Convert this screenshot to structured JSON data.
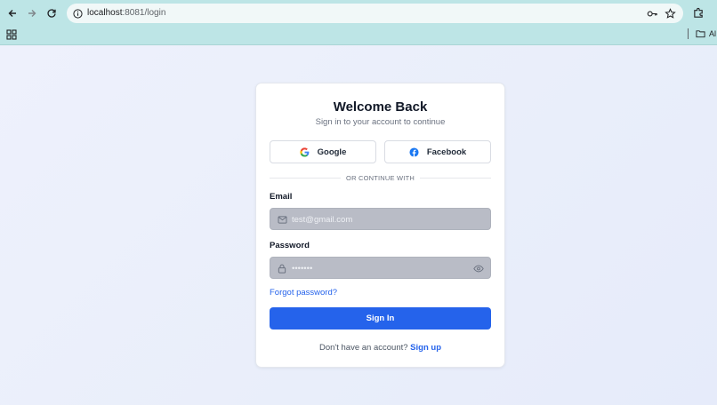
{
  "browser": {
    "url_host": "localhost",
    "url_path": ":8081/login",
    "bookmark_folder": "Al"
  },
  "login": {
    "title": "Welcome Back",
    "subtitle": "Sign in to your account to continue",
    "google_label": "Google",
    "facebook_label": "Facebook",
    "divider_text": "OR CONTINUE WITH",
    "email_label": "Email",
    "email_placeholder": "test@gmail.com",
    "password_label": "Password",
    "password_value": "•••••••",
    "forgot_label": "Forgot password?",
    "signin_label": "Sign In",
    "no_account_text": "Don't have an account?",
    "signup_label": "Sign up"
  },
  "colors": {
    "accent": "#2563eb",
    "chrome": "#bde5e6",
    "field_bg": "#b9bcc6"
  },
  "icons": {
    "back": "arrow-left-icon",
    "forward": "arrow-right-icon",
    "reload": "reload-icon",
    "site_info": "info-icon",
    "key": "key-icon",
    "star": "star-icon",
    "extensions": "puzzle-icon",
    "apps": "apps-grid-icon",
    "folder": "folder-icon",
    "google": "google-icon",
    "facebook": "facebook-icon",
    "mail": "mail-icon",
    "lock": "lock-icon",
    "eye": "eye-icon"
  }
}
